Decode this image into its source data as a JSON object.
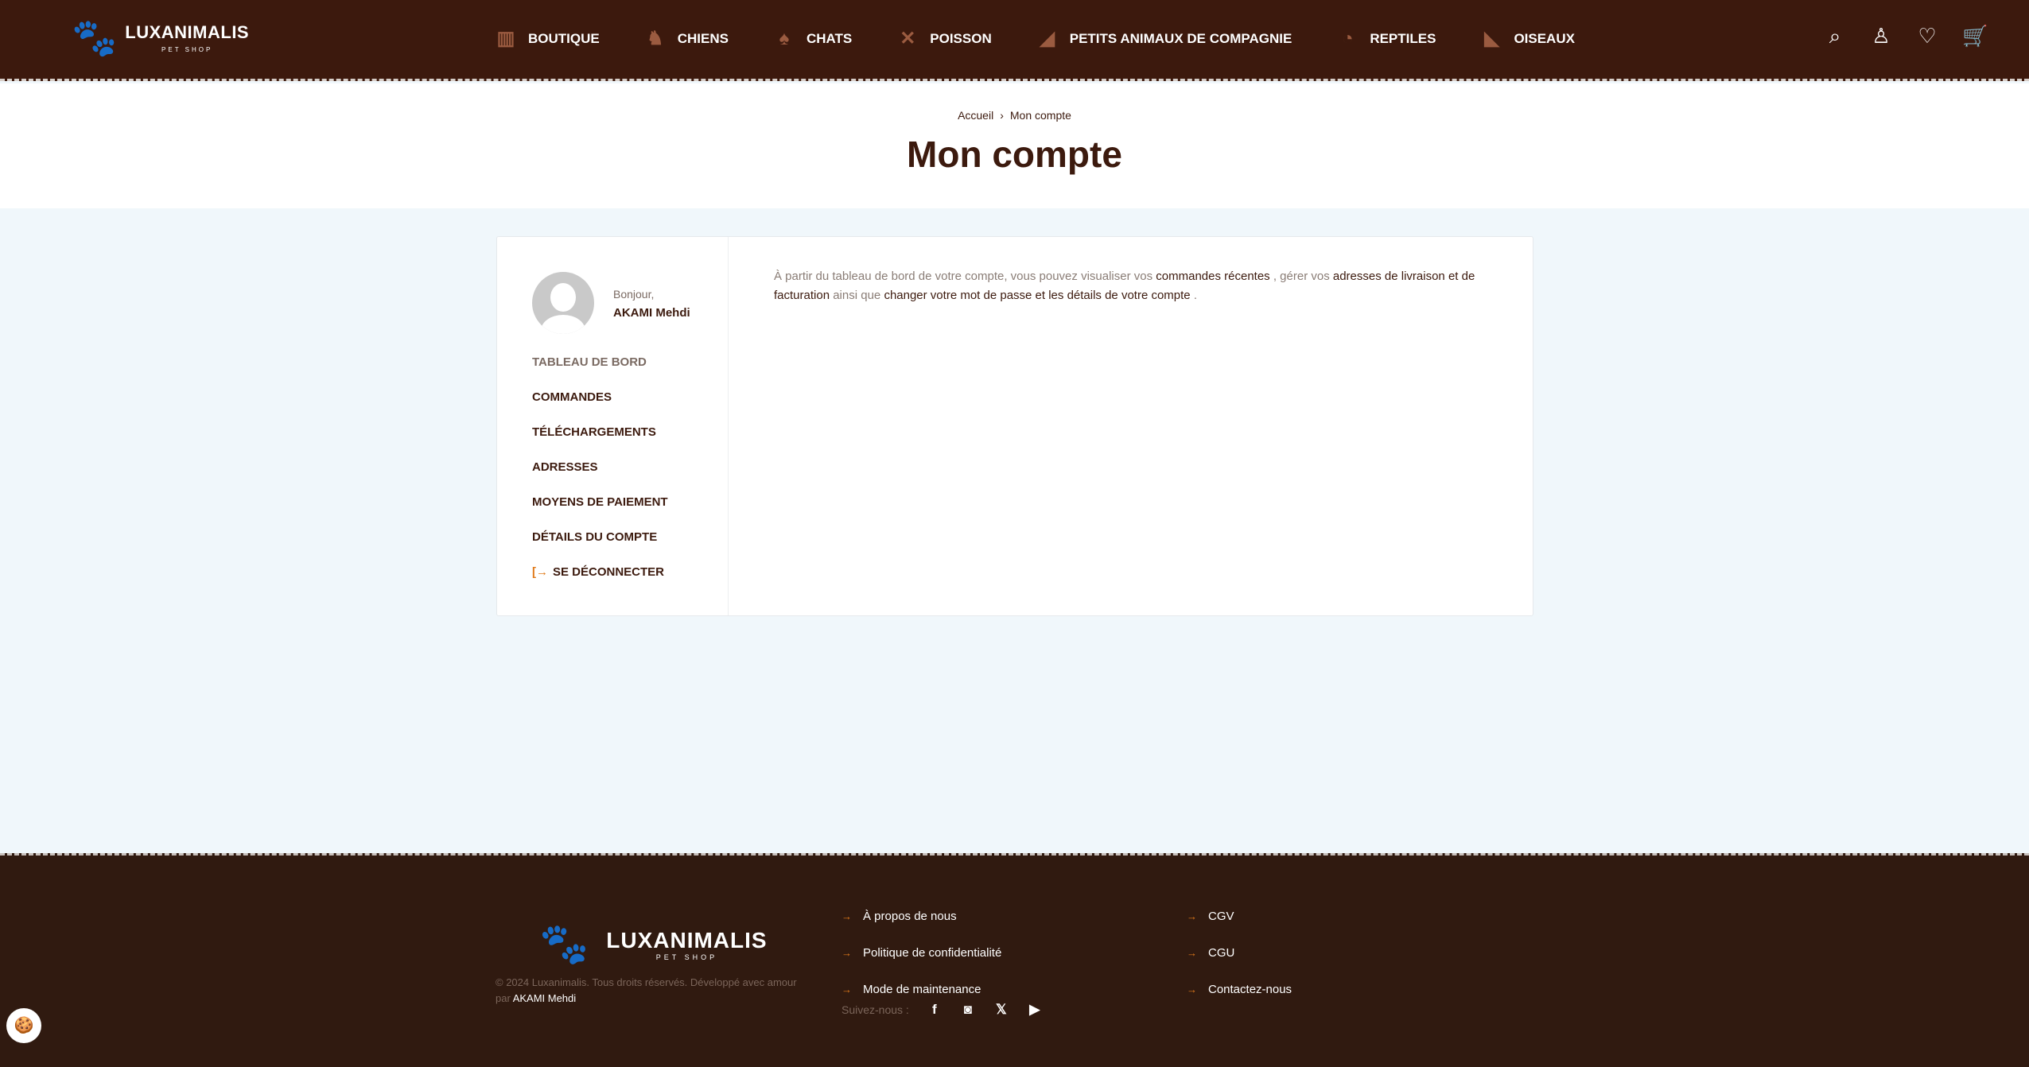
{
  "brand": {
    "name": "LUXANIMALIS",
    "tagline": "PET SHOP"
  },
  "nav": [
    {
      "label": "BOUTIQUE",
      "icon": "shop-icon",
      "glyph": "▥"
    },
    {
      "label": "CHIENS",
      "icon": "dog-icon",
      "glyph": "♞"
    },
    {
      "label": "CHATS",
      "icon": "cat-icon",
      "glyph": "♠"
    },
    {
      "label": "POISSON",
      "icon": "fish-icon",
      "glyph": "✕"
    },
    {
      "label": "PETITS ANIMAUX DE COMPAGNIE",
      "icon": "small-animal-icon",
      "glyph": "◢"
    },
    {
      "label": "REPTILES",
      "icon": "reptile-icon",
      "glyph": "◔"
    },
    {
      "label": "OISEAUX",
      "icon": "bird-icon",
      "glyph": "◣"
    }
  ],
  "header_icons": {
    "search": "⌕",
    "account": "♙",
    "wishlist": "♡",
    "cart": "🛒"
  },
  "breadcrumb": {
    "home": "Accueil",
    "sep": "›",
    "current": "Mon compte"
  },
  "page_title": "Mon compte",
  "account": {
    "greeting": "Bonjour,",
    "user": "AKAMI Mehdi",
    "menu": [
      "TABLEAU DE BORD",
      "COMMANDES",
      "TÉLÉCHARGEMENTS",
      "ADRESSES",
      "MOYENS DE PAIEMENT",
      "DÉTAILS DU COMPTE"
    ],
    "logout": "SE DÉCONNECTER",
    "intro": {
      "t1": "À partir du tableau de bord de votre compte, vous pouvez visualiser vos ",
      "l1": "commandes récentes",
      "t2": " , gérer vos ",
      "l2": "adresses de livraison et de facturation",
      "t3": " ainsi que ",
      "l3": "changer votre mot de passe et les détails de votre compte",
      "t4": " ."
    }
  },
  "footer": {
    "copyright": "© 2024 Luxanimalis. Tous droits réservés. Développé avec amour par ",
    "author": "AKAMI Mehdi",
    "col1": [
      "À propos de nous",
      "Politique de confidentialité",
      "Mode de maintenance"
    ],
    "col2": [
      "CGV",
      "CGU",
      "Contactez-nous"
    ],
    "follow": "Suivez-nous :",
    "social": [
      "f",
      "◙",
      "𝕏",
      "▶"
    ]
  },
  "colors": {
    "header": "#3c190d",
    "footer": "#301a10",
    "accent": "#e07a1a",
    "icon": "#9b5b40"
  }
}
